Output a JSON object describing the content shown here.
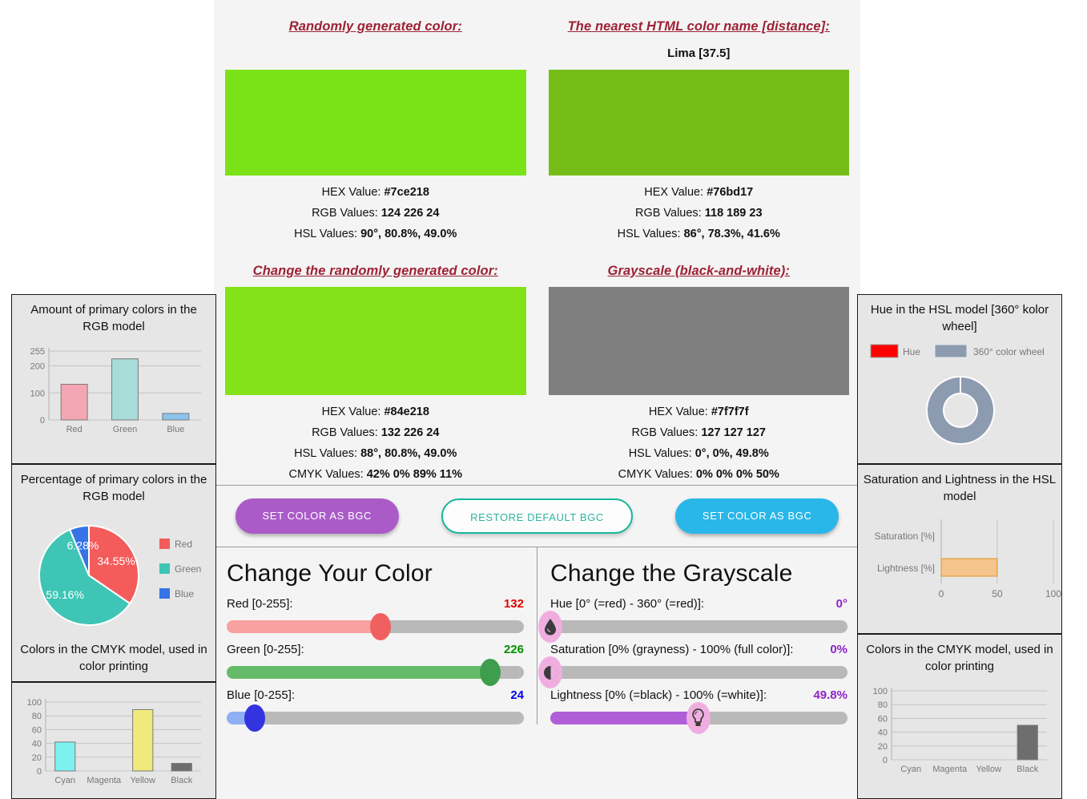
{
  "center": {
    "random": {
      "heading": "Randomly generated color:",
      "swatch_hex": "#7ce218",
      "rows": [
        {
          "label": "HEX Value: ",
          "value": "#7ce218"
        },
        {
          "label": "RGB Values: ",
          "value": "124 226 24"
        },
        {
          "label": "HSL Values: ",
          "value": "90°, 80.8%, 49.0%"
        }
      ]
    },
    "nearest": {
      "heading": "The nearest HTML color name [distance]:",
      "name": "Lima [37.5]",
      "swatch_hex": "#76bd17",
      "rows": [
        {
          "label": "HEX Value: ",
          "value": "#76bd17"
        },
        {
          "label": "RGB Values: ",
          "value": "118 189 23"
        },
        {
          "label": "HSL Values: ",
          "value": "86°, 78.3%, 41.6%"
        }
      ]
    },
    "changed": {
      "heading": "Change the randomly generated color:",
      "swatch_hex": "#84e218",
      "rows": [
        {
          "label": "HEX Value: ",
          "value": "#84e218"
        },
        {
          "label": "RGB Values: ",
          "value": "132 226 24"
        },
        {
          "label": "HSL Values: ",
          "value": "88°, 80.8%, 49.0%"
        },
        {
          "label": "CMYK Values: ",
          "value": "42% 0% 89% 11%"
        }
      ]
    },
    "grayscale": {
      "heading": "Grayscale (black-and-white):",
      "swatch_hex": "#7f7f7f",
      "rows": [
        {
          "label": "HEX Value: ",
          "value": "#7f7f7f"
        },
        {
          "label": "RGB Values: ",
          "value": "127 127 127"
        },
        {
          "label": "HSL Values: ",
          "value": "0°, 0%, 49.8%"
        },
        {
          "label": "CMYK Values: ",
          "value": "0% 0% 0% 50%"
        }
      ]
    },
    "buttons": {
      "set_color_left": "SET COLOR AS BGC",
      "restore": "RESTORE DEFAULT BGC",
      "set_color_right": "SET COLOR AS BGC"
    },
    "rgb_panel": {
      "title": "Change Your Color",
      "sliders": [
        {
          "label": "Red [0-255]:",
          "value": "132",
          "value_num": 132,
          "max": 255,
          "color": "#f06060",
          "fill": "#f9a0a0",
          "text_color": "#e60000"
        },
        {
          "label": "Green [0-255]:",
          "value": "226",
          "value_num": 226,
          "max": 255,
          "color": "#3f9e4d",
          "fill": "#66bb6a",
          "text_color": "#009000"
        },
        {
          "label": "Blue [0-255]:",
          "value": "24",
          "value_num": 24,
          "max": 255,
          "color": "#3333e0",
          "fill": "#8fb0f5",
          "text_color": "#0000ee"
        }
      ]
    },
    "hsl_panel": {
      "title": "Change the Grayscale",
      "sliders": [
        {
          "label": "Hue [0° (=red) - 360° (=red)]:",
          "value": "0°",
          "value_num": 0,
          "max": 360,
          "icon": "droplet-icon",
          "fill": "#b05ed8",
          "text_color": "#8e24c8"
        },
        {
          "label": "Saturation [0% (grayness) - 100% (full color)]:",
          "value": "0%",
          "value_num": 0,
          "max": 100,
          "icon": "contrast-icon",
          "fill": "#b05ed8",
          "text_color": "#8e24c8"
        },
        {
          "label": "Lightness [0% (=black) - 100% (=white)]:",
          "value": "49.8%",
          "value_num": 49.8,
          "max": 100,
          "icon": "lightbulb-icon",
          "fill": "#b05ed8",
          "text_color": "#8e24c8"
        }
      ]
    }
  },
  "left_panels": [
    {
      "title": "Amount of primary colors in the RGB model"
    },
    {
      "title": "Percentage of primary colors in the RGB model"
    },
    {
      "title": "Colors in the CMYK model, used in color printing"
    }
  ],
  "right_panels": [
    {
      "title": "Hue in the HSL model [360° kolor wheel]"
    },
    {
      "title": "Saturation and Lightness in the HSL model"
    },
    {
      "title": "Colors in the CMYK model, used in color printing"
    }
  ],
  "chart_data": [
    {
      "type": "bar",
      "id": "rgb-amount-bar",
      "title": "Amount of primary colors in the RGB model",
      "categories": [
        "Red",
        "Green",
        "Blue"
      ],
      "values": [
        132,
        226,
        24
      ],
      "colors": [
        "#f4a6b4",
        "#a8dcd8",
        "#8bc4ec"
      ],
      "yticks": [
        0,
        100,
        200,
        255
      ],
      "ylim": [
        0,
        255
      ],
      "xlabel": "",
      "ylabel": "",
      "grid": true,
      "legend": "none"
    },
    {
      "type": "pie",
      "id": "rgb-percent-pie",
      "title": "Percentage of primary colors in the RGB model",
      "labels": [
        "Red",
        "Green",
        "Blue"
      ],
      "values": [
        34.55,
        59.16,
        6.28
      ],
      "value_labels": [
        "34.55%",
        "59.16%",
        "6.28%"
      ],
      "colors": [
        "#f45b5b",
        "#3ec5b5",
        "#3573e6"
      ],
      "legend": "right"
    },
    {
      "type": "bar",
      "id": "cmyk-color-bar",
      "title": "Colors in the CMYK model, used in color printing",
      "categories": [
        "Cyan",
        "Magenta",
        "Yellow",
        "Black"
      ],
      "values": [
        42,
        0,
        89,
        11
      ],
      "colors": [
        "#7df0f0",
        "#f07df0",
        "#f0ea7d",
        "#6e6e6e"
      ],
      "yticks": [
        0,
        20,
        40,
        60,
        80,
        100
      ],
      "ylim": [
        0,
        100
      ],
      "grid": true,
      "legend": "none"
    },
    {
      "type": "pie",
      "id": "hue-donut",
      "title": "Hue in the HSL model [360° kolor wheel]",
      "labels": [
        "Hue",
        "360° color wheel"
      ],
      "values": [
        0,
        360
      ],
      "colors": [
        "#ff0000",
        "#8c9bb0"
      ],
      "donut": true,
      "legend": "top"
    },
    {
      "type": "bar",
      "id": "sat-light-hbar",
      "orientation": "horizontal",
      "title": "Saturation and Lightness in the HSL model",
      "categories": [
        "Saturation [%]",
        "Lightness [%]"
      ],
      "values": [
        0,
        49.8
      ],
      "colors": [
        "#f5c48d",
        "#f5c48d"
      ],
      "xticks": [
        0,
        50,
        100
      ],
      "xlim": [
        0,
        100
      ],
      "grid": true,
      "legend": "none"
    },
    {
      "type": "bar",
      "id": "cmyk-gray-bar",
      "title": "Colors in the CMYK model, used in color printing",
      "categories": [
        "Cyan",
        "Magenta",
        "Yellow",
        "Black"
      ],
      "values": [
        0,
        0,
        0,
        50
      ],
      "colors": [
        "#7df0f0",
        "#f07df0",
        "#f0ea7d",
        "#6e6e6e"
      ],
      "yticks": [
        0,
        20,
        40,
        60,
        80,
        100
      ],
      "ylim": [
        0,
        100
      ],
      "grid": true,
      "legend": "none"
    }
  ],
  "legends": {
    "rgb_pie": [
      "Red",
      "Green",
      "Blue"
    ],
    "hue_donut": [
      "Hue",
      "360° color wheel"
    ]
  }
}
